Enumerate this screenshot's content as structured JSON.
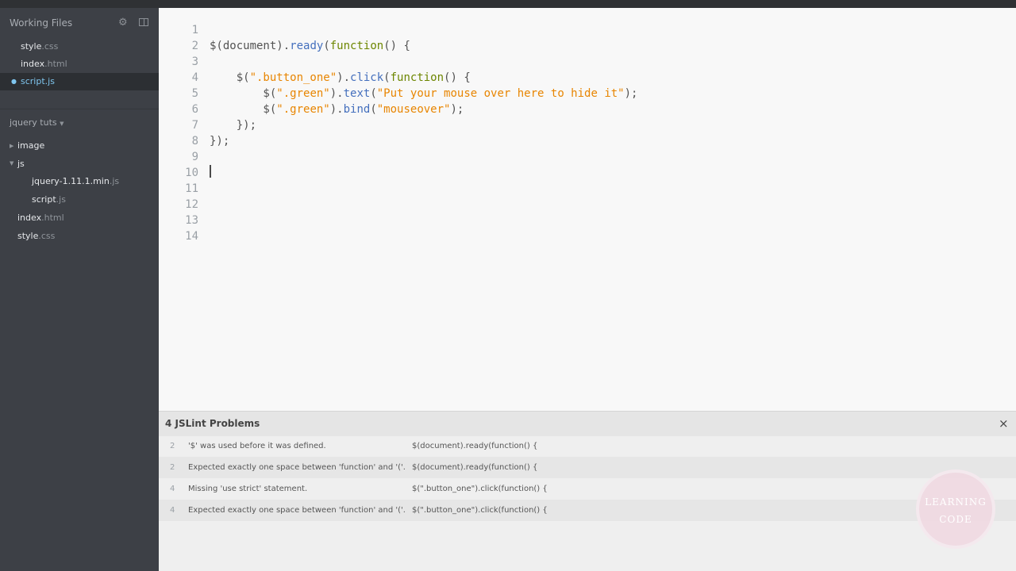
{
  "sidebar": {
    "working_files_title": "Working Files",
    "working_files": [
      {
        "base": "style",
        "ext": ".css",
        "active": false
      },
      {
        "base": "index",
        "ext": ".html",
        "active": false
      },
      {
        "base": "script",
        "ext": ".js",
        "active": true
      }
    ],
    "project": {
      "title": "jquery tuts",
      "folders": [
        {
          "name": "image",
          "expanded": false
        },
        {
          "name": "js",
          "expanded": true,
          "children": [
            {
              "base": "jquery-1.11.1.min",
              "ext": ".js"
            },
            {
              "base": "script",
              "ext": ".js"
            }
          ]
        }
      ],
      "files": [
        {
          "base": "index",
          "ext": ".html"
        },
        {
          "base": "style",
          "ext": ".css"
        }
      ]
    }
  },
  "editor": {
    "line_numbers": [
      "1",
      "2",
      "3",
      "4",
      "5",
      "6",
      "7",
      "8",
      "9",
      "10",
      "11",
      "12",
      "13",
      "14"
    ],
    "lines": [
      [],
      [
        {
          "t": "$(document).",
          "c": ""
        },
        {
          "t": "ready",
          "c": "fn"
        },
        {
          "t": "(",
          "c": ""
        },
        {
          "t": "function",
          "c": "kw"
        },
        {
          "t": "() {",
          "c": ""
        }
      ],
      [],
      [
        {
          "t": "    $(",
          "c": ""
        },
        {
          "t": "\".button_one\"",
          "c": "str"
        },
        {
          "t": ").",
          "c": ""
        },
        {
          "t": "click",
          "c": "fn"
        },
        {
          "t": "(",
          "c": ""
        },
        {
          "t": "function",
          "c": "kw"
        },
        {
          "t": "() {",
          "c": ""
        }
      ],
      [
        {
          "t": "        $(",
          "c": ""
        },
        {
          "t": "\".green\"",
          "c": "str"
        },
        {
          "t": ").",
          "c": ""
        },
        {
          "t": "text",
          "c": "fn"
        },
        {
          "t": "(",
          "c": ""
        },
        {
          "t": "\"Put your mouse over here to hide it\"",
          "c": "str"
        },
        {
          "t": ");",
          "c": ""
        }
      ],
      [
        {
          "t": "        $(",
          "c": ""
        },
        {
          "t": "\".green\"",
          "c": "str"
        },
        {
          "t": ").",
          "c": ""
        },
        {
          "t": "bind",
          "c": "fn"
        },
        {
          "t": "(",
          "c": ""
        },
        {
          "t": "\"mouseover\"",
          "c": "str"
        },
        {
          "t": ");",
          "c": ""
        }
      ],
      [
        {
          "t": "    });",
          "c": ""
        }
      ],
      [
        {
          "t": "});",
          "c": ""
        }
      ],
      [],
      [],
      [],
      [],
      [],
      []
    ],
    "syntax_colors": {
      "keyword": "#6d8600",
      "function": "#446fbd",
      "string": "#e88501",
      "plain": "#535353"
    }
  },
  "problems": {
    "title": "4 JSLint Problems",
    "close_symbol": "×",
    "rows": [
      {
        "line": "2",
        "message": "'$' was used before it was defined.",
        "source": "$(document).ready(function() {"
      },
      {
        "line": "2",
        "message": "Expected exactly one space between 'function' and '('.",
        "source": "$(document).ready(function() {"
      },
      {
        "line": "4",
        "message": "Missing 'use strict' statement.",
        "source": "$(\".button_one\").click(function() {"
      },
      {
        "line": "4",
        "message": "Expected exactly one space between 'function' and '('.",
        "source": "$(\".button_one\").click(function() {"
      }
    ]
  },
  "watermark": {
    "line1": "LEARNING",
    "line2": "CODE"
  },
  "colors": {
    "sidebar_bg": "#3d4046",
    "editor_bg": "#f8f8f8",
    "active_file": "#7fc6ef"
  }
}
